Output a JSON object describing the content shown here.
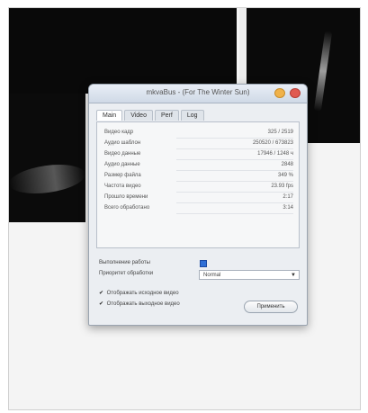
{
  "window": {
    "title": "mkvaBus - (For The Winter Sun)",
    "controls": [
      "minimize",
      "close"
    ],
    "tabs": [
      {
        "label": "Main",
        "active": true
      },
      {
        "label": "Video",
        "active": false
      },
      {
        "label": "Perf",
        "active": false
      },
      {
        "label": "Log",
        "active": false
      }
    ],
    "stats": [
      {
        "label": "Видео кадр",
        "value": "325 / 2519"
      },
      {
        "label": "Аудио шаблон",
        "value": "250520 / 673823"
      },
      {
        "label": "Видео данные",
        "value": "17946 / 1248 ч"
      },
      {
        "label": "Аудио данные",
        "value": "2848"
      },
      {
        "label": "Размер файла",
        "value": "349 %"
      },
      {
        "label": "Частота видео",
        "value": "23.93 fps"
      },
      {
        "label": "Прошло времени",
        "value": "2:17"
      },
      {
        "label": "Всего обработано",
        "value": "3:14"
      }
    ],
    "controls_section": {
      "realtime_label": "Выполнение работы",
      "priority_label": "Приоритет обработки",
      "priority_value": "Normal",
      "check1_label": "Отображать исходное видео",
      "check2_label": "Отображать выходное видео",
      "apply_label": "Применить"
    }
  },
  "icons": {
    "minimize": "minimize-icon",
    "close": "close-icon",
    "checkmark": "checkmark-icon",
    "dropdown": "chevron-down-icon"
  }
}
